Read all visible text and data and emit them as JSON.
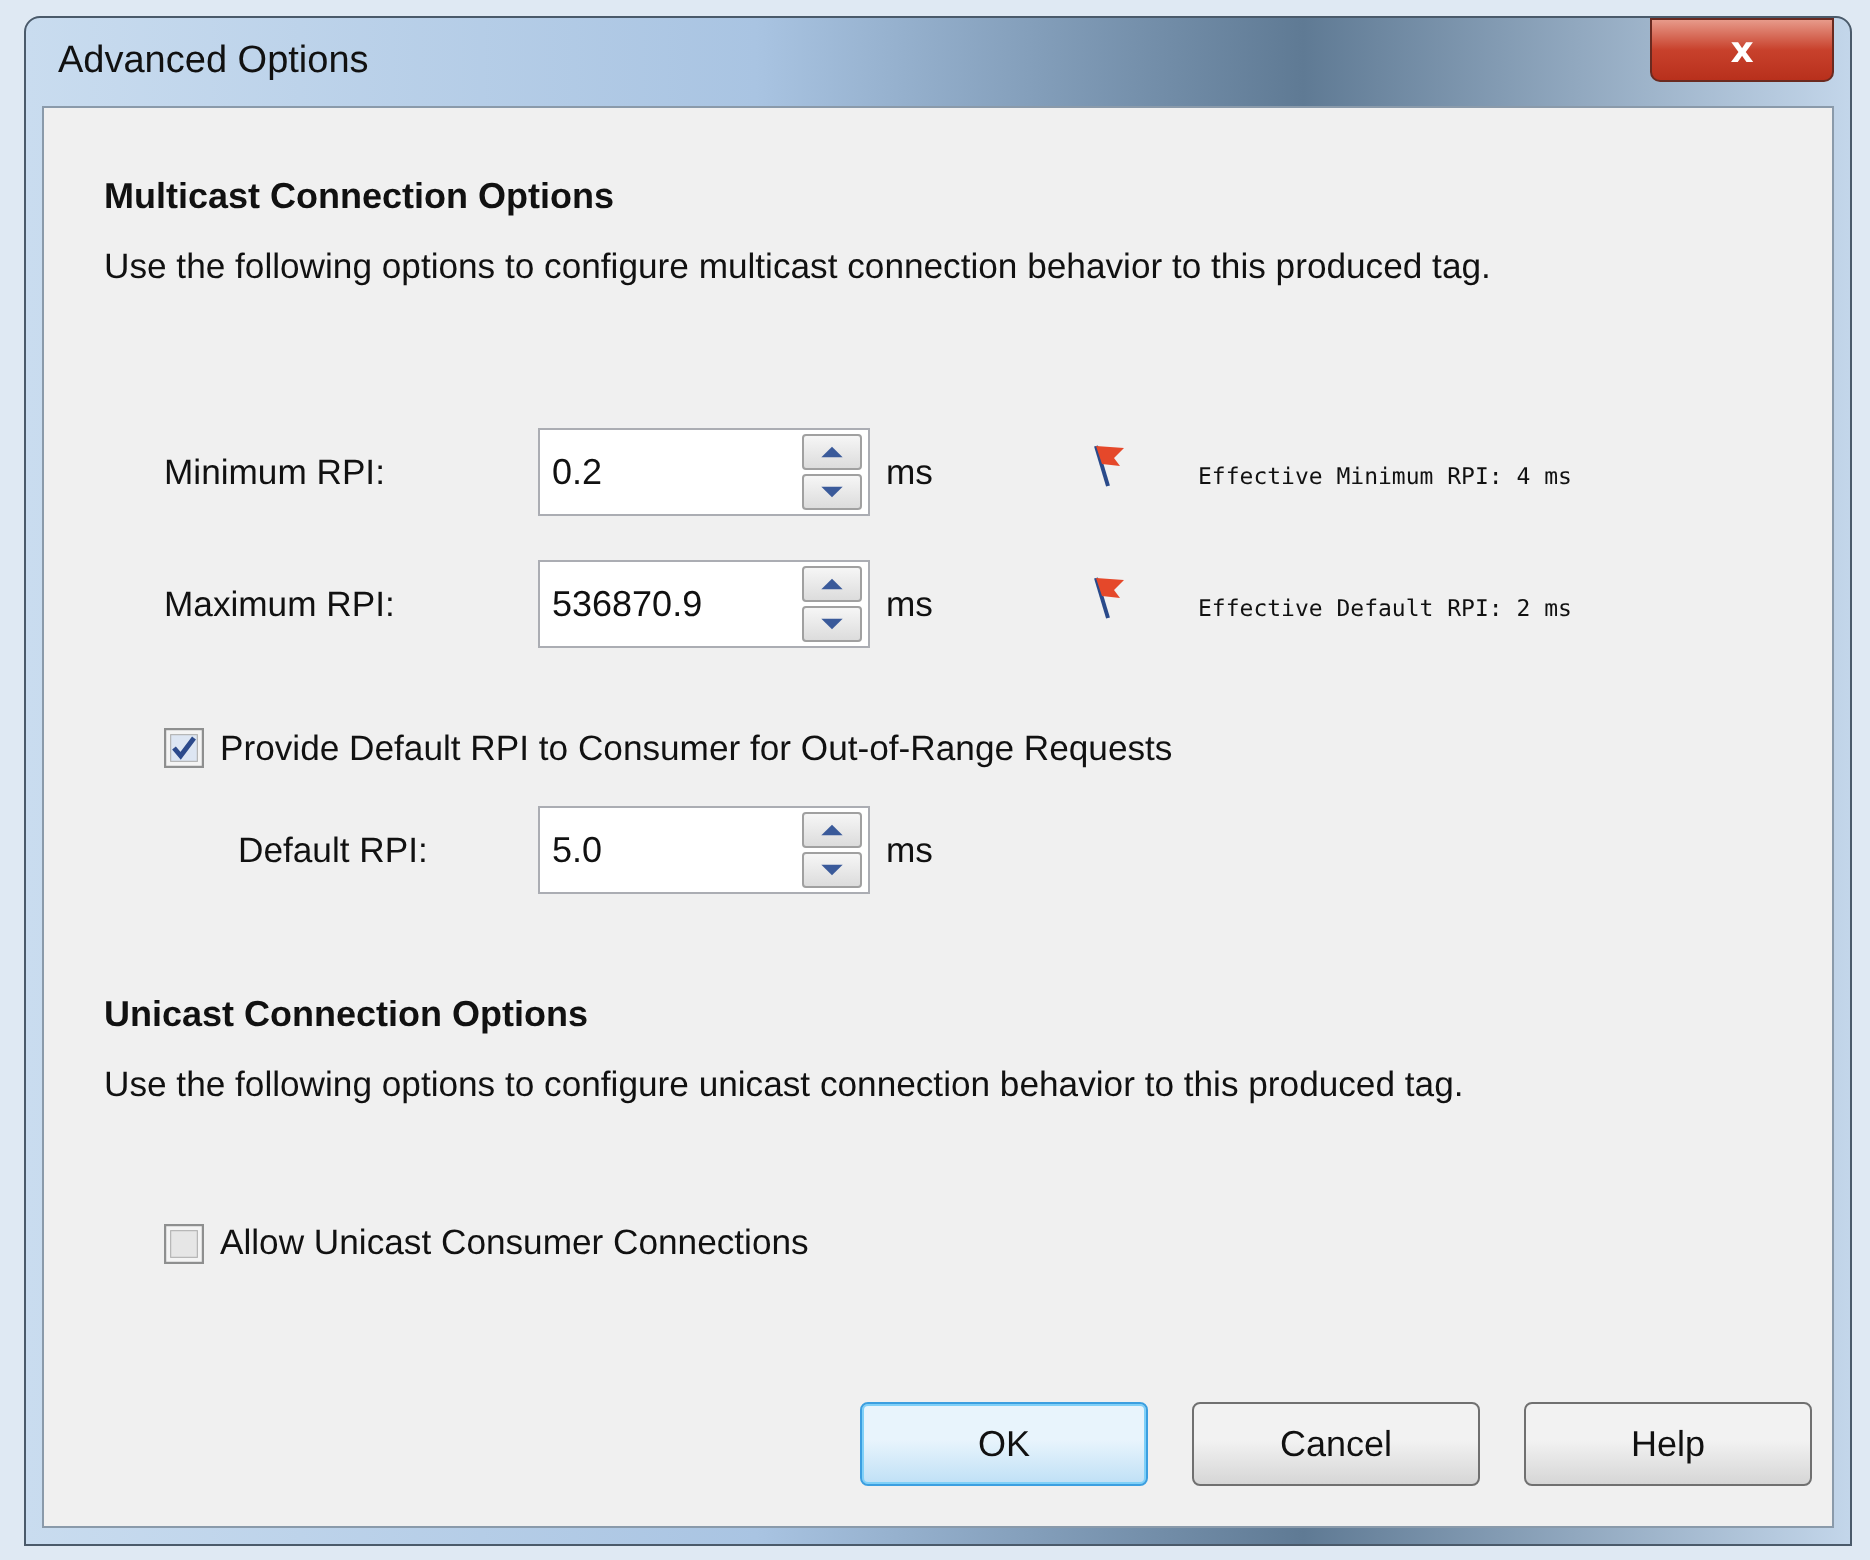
{
  "window": {
    "title": "Advanced Options",
    "close": "x"
  },
  "multicast": {
    "heading": "Multicast Connection Options",
    "description": "Use the following options to configure multicast connection behavior to this produced tag.",
    "rpi_fields": [
      {
        "label": "Minimum RPI:",
        "value": "0.2",
        "unit": "ms",
        "note": "Effective Minimum RPI: 4 ms"
      },
      {
        "label": "Maximum RPI:",
        "value": "536870.9",
        "unit": "ms",
        "note": "Effective Default RPI: 2 ms"
      }
    ],
    "default_option": {
      "label": "Provide Default RPI to Consumer for Out-of-Range Requests",
      "checked": true
    },
    "default_rpi": {
      "label": "Default RPI:",
      "value": "5.0",
      "unit": "ms"
    }
  },
  "unicast": {
    "heading": "Unicast Connection Options",
    "description": "Use the following options to configure unicast connection behavior to this produced tag.",
    "option": {
      "label": "Allow Unicast Consumer Connections",
      "checked": false
    }
  },
  "buttons": [
    {
      "label": "OK",
      "default": true
    },
    {
      "label": "Cancel",
      "default": false
    },
    {
      "label": "Help",
      "default": false
    }
  ]
}
